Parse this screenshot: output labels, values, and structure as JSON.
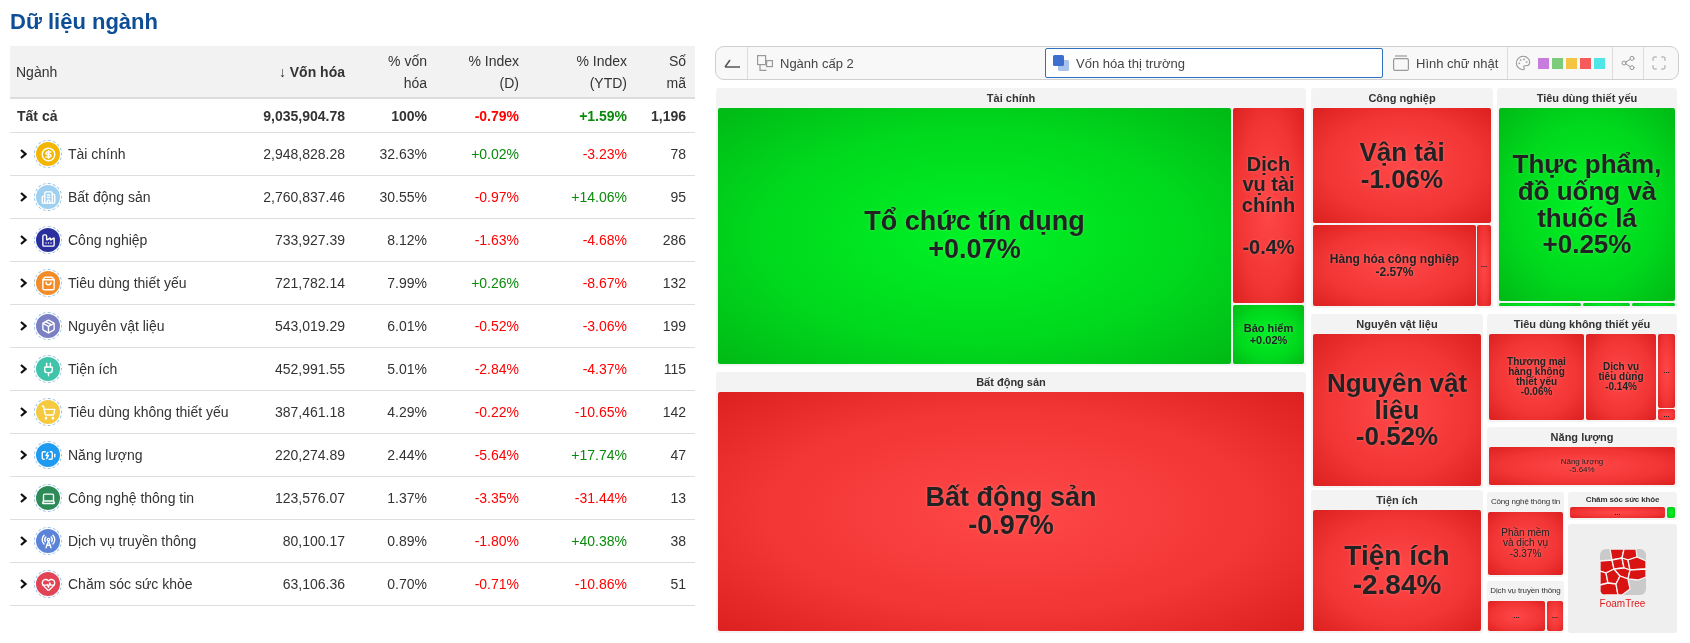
{
  "title": "Dữ liệu ngành",
  "table": {
    "columns": [
      {
        "label": "Ngành",
        "sorted": false
      },
      {
        "label": "↓ Vốn hóa",
        "sorted": true
      },
      {
        "label": "% vốn hóa",
        "sorted": false
      },
      {
        "label": "% Index (D)",
        "sorted": false
      },
      {
        "label": "% Index (YTD)",
        "sorted": false
      },
      {
        "label": "Số mã",
        "sorted": false
      }
    ],
    "total": {
      "name": "Tất cả",
      "cap": "9,035,904.78",
      "cap_share": "100%",
      "index_d": {
        "value": "-0.79%",
        "gain": false
      },
      "index_ytd": {
        "value": "+1.59%",
        "gain": true
      },
      "count": "1,196"
    },
    "rows": [
      {
        "name": "Tài chính",
        "color": "#f2b705",
        "expanded": false,
        "cap": "2,948,828.28",
        "cap_share": "32.63%",
        "index_d": {
          "value": "+0.02%",
          "gain": true
        },
        "index_ytd": {
          "value": "-3.23%",
          "gain": false
        },
        "count": "78"
      },
      {
        "name": "Bất động sản",
        "color": "#9fd0f0",
        "expanded": false,
        "cap": "2,760,837.46",
        "cap_share": "30.55%",
        "index_d": {
          "value": "-0.97%",
          "gain": false
        },
        "index_ytd": {
          "value": "+14.06%",
          "gain": true
        },
        "count": "95"
      },
      {
        "name": "Công nghiệp",
        "color": "#2b2f9e",
        "expanded": false,
        "cap": "733,927.39",
        "cap_share": "8.12%",
        "index_d": {
          "value": "-1.63%",
          "gain": false
        },
        "index_ytd": {
          "value": "-4.68%",
          "gain": false
        },
        "count": "286"
      },
      {
        "name": "Tiêu dùng thiết yếu",
        "color": "#f28c28",
        "expanded": false,
        "cap": "721,782.14",
        "cap_share": "7.99%",
        "index_d": {
          "value": "+0.26%",
          "gain": true
        },
        "index_ytd": {
          "value": "-8.67%",
          "gain": false
        },
        "count": "132"
      },
      {
        "name": "Nguyên vật liệu",
        "color": "#7b80c4",
        "expanded": false,
        "cap": "543,019.29",
        "cap_share": "6.01%",
        "index_d": {
          "value": "-0.52%",
          "gain": false
        },
        "index_ytd": {
          "value": "-3.06%",
          "gain": false
        },
        "count": "199"
      },
      {
        "name": "Tiện ích",
        "color": "#3fc4a9",
        "expanded": false,
        "cap": "452,991.55",
        "cap_share": "5.01%",
        "index_d": {
          "value": "-2.84%",
          "gain": false
        },
        "index_ytd": {
          "value": "-4.37%",
          "gain": false
        },
        "count": "115"
      },
      {
        "name": "Tiêu dùng không thiết yếu",
        "color": "#f5c940",
        "expanded": false,
        "cap": "387,461.18",
        "cap_share": "4.29%",
        "index_d": {
          "value": "-0.22%",
          "gain": false
        },
        "index_ytd": {
          "value": "-10.65%",
          "gain": false
        },
        "count": "142"
      },
      {
        "name": "Năng lượng",
        "color": "#1e9bf0",
        "expanded": false,
        "cap": "220,274.89",
        "cap_share": "2.44%",
        "index_d": {
          "value": "-5.64%",
          "gain": false
        },
        "index_ytd": {
          "value": "+17.74%",
          "gain": true
        },
        "count": "47"
      },
      {
        "name": "Công nghệ thông tin",
        "color": "#2e8b57",
        "expanded": false,
        "cap": "123,576.07",
        "cap_share": "1.37%",
        "index_d": {
          "value": "-3.35%",
          "gain": false
        },
        "index_ytd": {
          "value": "-31.44%",
          "gain": false
        },
        "count": "13"
      },
      {
        "name": "Dịch vụ truyền thông",
        "color": "#5b84d8",
        "expanded": false,
        "cap": "80,100.17",
        "cap_share": "0.89%",
        "index_d": {
          "value": "-1.80%",
          "gain": false
        },
        "index_ytd": {
          "value": "+40.38%",
          "gain": true
        },
        "count": "38"
      },
      {
        "name": "Chăm sóc sức khỏe",
        "color": "#e04455",
        "expanded": false,
        "cap": "63,106.36",
        "cap_share": "0.70%",
        "index_d": {
          "value": "-0.71%",
          "gain": false
        },
        "index_ytd": {
          "value": "-10.86%",
          "gain": false
        },
        "count": "51"
      }
    ]
  },
  "toolbar": {
    "segments": [
      {
        "label": "Ngành cấp 2",
        "selected": false
      },
      {
        "label": "Vốn hóa thị trường",
        "selected": true
      },
      {
        "label": "Hình chữ nhật",
        "selected": false
      }
    ],
    "palette": [
      {
        "color": "#c77dde"
      },
      {
        "color": "#7ccc7c"
      },
      {
        "color": "#f6c443"
      },
      {
        "color": "#f65a5a"
      },
      {
        "color": "#4ee6e6"
      }
    ]
  },
  "treemap": {
    "groups": [
      {
        "title": "Tài chính",
        "cells": [
          {
            "label": "Tổ chức tín dụng",
            "change": "+0.07%",
            "gain": true
          },
          {
            "label": "Dịch vụ tài chính",
            "change": "-0.4%",
            "gain": false
          },
          {
            "label": "Bảo hiểm",
            "change": "+0.02%",
            "gain": true
          }
        ]
      },
      {
        "title": "Bất động sản",
        "cells": [
          {
            "label": "Bất động sản",
            "change": "-0.97%",
            "gain": false
          }
        ]
      },
      {
        "title": "Công nghiệp",
        "cells": [
          {
            "label": "Vận tải",
            "change": "-1.06%",
            "gain": false
          },
          {
            "label": "Hàng hóa công nghiệp",
            "change": "-2.57%",
            "gain": false
          },
          {
            "label": "...",
            "gain": false
          }
        ]
      },
      {
        "title": "Tiêu dùng thiết yếu",
        "cells": [
          {
            "label": "Thực phẩm, đồ uống và thuốc lá",
            "change": "+0.25%",
            "gain": true
          },
          {
            "gain": true
          },
          {
            "gain": true
          },
          {
            "gain": true
          }
        ]
      },
      {
        "title": "Nguyên vật liệu",
        "cells": [
          {
            "label": "Nguyên vật liệu",
            "change": "-0.52%",
            "gain": false
          }
        ]
      },
      {
        "title": "Tiện ích",
        "cells": [
          {
            "label": "Tiện ích",
            "change": "-2.84%",
            "gain": false
          }
        ]
      },
      {
        "title": "Tiêu dùng không thiết yếu",
        "cells": [
          {
            "label": "Thương mại hàng không thiết yếu",
            "change": "-0.06%",
            "gain": false
          },
          {
            "label": "Dịch vụ tiêu dùng",
            "change": "-0.14%",
            "gain": false
          },
          {
            "label": "...",
            "gain": false
          },
          {
            "label": "...",
            "gain": false
          }
        ]
      },
      {
        "title": "Năng lượng",
        "cells": [
          {
            "label": "Năng lượng",
            "change": "-5.64%",
            "gain": false
          }
        ]
      },
      {
        "title": "Công nghệ thông tin",
        "cells": [
          {
            "label": "Phần mềm và dịch vụ",
            "change": "-3.37%",
            "gain": false
          }
        ]
      },
      {
        "title": "Dịch vụ truyền thông",
        "cells": [
          {
            "label": "...",
            "gain": false
          },
          {
            "label": "...",
            "gain": false
          }
        ]
      },
      {
        "title": "Chăm sóc sức khỏe",
        "cells": [
          {
            "label": "...",
            "gain": false
          },
          {
            "gain": true
          }
        ]
      }
    ],
    "logo": {
      "text": "FoamTree"
    }
  }
}
